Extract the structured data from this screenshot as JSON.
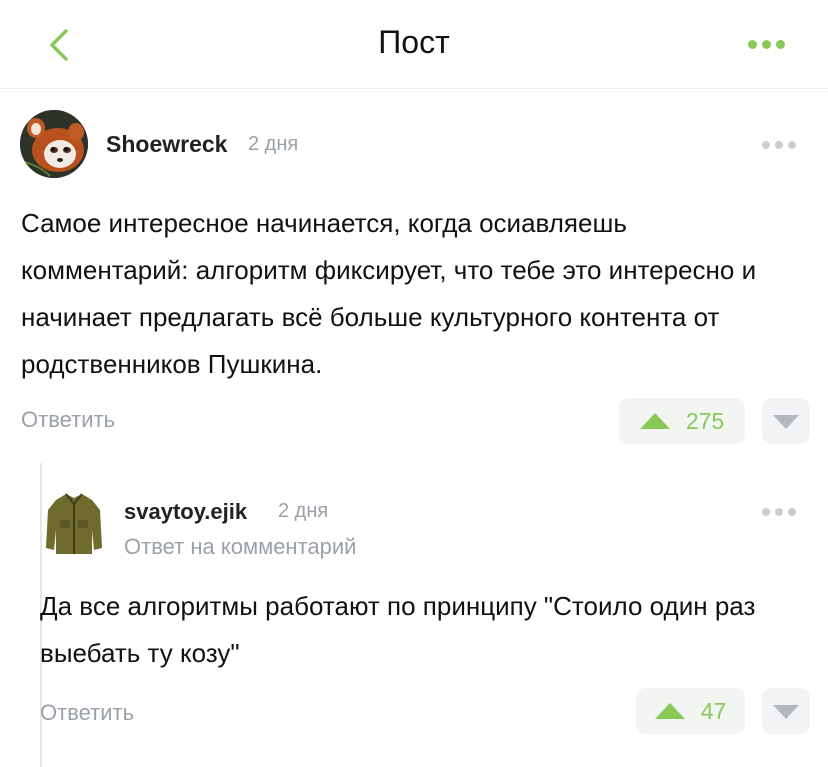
{
  "header": {
    "title": "Пост",
    "accent_color": "#8ac858",
    "back_icon": "chevron-left-icon",
    "menu_icon": "more-dots-icon"
  },
  "comments": [
    {
      "author": "Shoewreck",
      "time": "2 дня",
      "avatar_icon": "red-panda-avatar",
      "text": "Самое интересное начинается, когда осиавляешь комментарий: алгоритм фиксирует, что тебе это интересно и начинает предлагать всё больше культурного контента от родственников Пушкина.",
      "reply_label": "Ответить",
      "votes": "275"
    },
    {
      "author": "svaytoy.ejik",
      "time": "2 дня",
      "avatar_icon": "jacket-avatar",
      "reply_to_prefix": "Ответ на",
      "reply_to_link": "комментарий",
      "text": "Да все алгоритмы работают по принципу \"Стоило один раз выебать ту козу\"",
      "reply_label": "Ответить",
      "votes": "47"
    }
  ]
}
